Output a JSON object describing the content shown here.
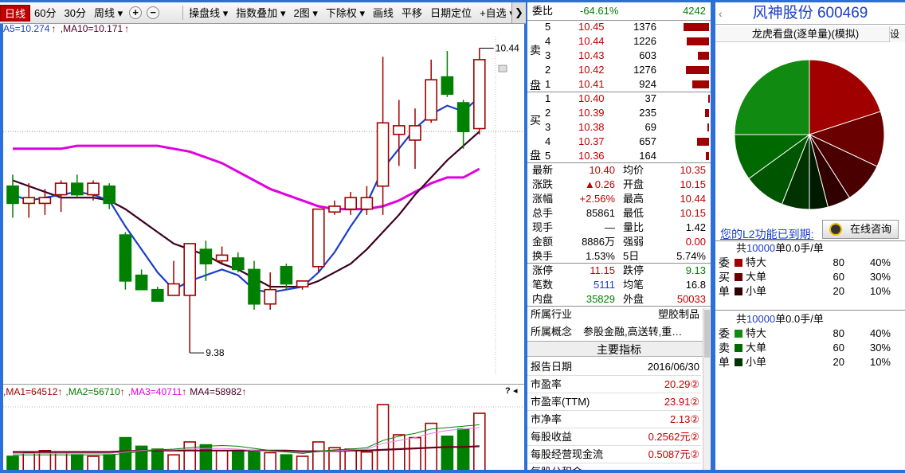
{
  "toolbar": {
    "period_tabs": [
      "日线",
      "60分",
      "30分",
      "周线"
    ],
    "active_period": "日线",
    "buttons": [
      "操盘线",
      "指数叠加",
      "2图",
      "下除权",
      "画线",
      "平移",
      "日期定位",
      "自选"
    ],
    "plus": "+",
    "minus": "−",
    "dropdown_arrow": "▾",
    "hide_icon": "❯"
  },
  "main_chart": {
    "ma_legend": [
      {
        "text": "A5=10.274",
        "color": "#1a3ec8"
      },
      {
        "text": ",MA10=10.171",
        "color": "#4a0020"
      }
    ],
    "price_high_label": "10.44",
    "price_low_label": "9.38",
    "colors": {
      "up": "#a00000",
      "down": "#008000",
      "ma5": "#1a3ec8",
      "ma10": "#3c0022",
      "ma_long": "#e000e0"
    }
  },
  "chart_data": {
    "type": "candlestick",
    "price_range": [
      9.3,
      10.48
    ],
    "candles": [
      {
        "o": 9.96,
        "c": 9.9,
        "h": 10.0,
        "l": 9.85
      },
      {
        "o": 9.9,
        "c": 9.92,
        "h": 9.97,
        "l": 9.85
      },
      {
        "o": 9.9,
        "c": 9.92,
        "h": 9.95,
        "l": 9.86
      },
      {
        "o": 9.93,
        "c": 9.97,
        "h": 9.98,
        "l": 9.87
      },
      {
        "o": 9.97,
        "c": 9.93,
        "h": 10.0,
        "l": 9.92
      },
      {
        "o": 9.93,
        "c": 9.97,
        "h": 9.98,
        "l": 9.91
      },
      {
        "o": 9.96,
        "c": 9.9,
        "h": 9.97,
        "l": 9.88
      },
      {
        "o": 9.79,
        "c": 9.63,
        "h": 9.8,
        "l": 9.6
      },
      {
        "o": 9.65,
        "c": 9.6,
        "h": 9.67,
        "l": 9.6
      },
      {
        "o": 9.6,
        "c": 9.56,
        "h": 9.61,
        "l": 9.56
      },
      {
        "o": 9.58,
        "c": 9.62,
        "h": 9.7,
        "l": 9.58
      },
      {
        "o": 9.58,
        "c": 9.76,
        "h": 9.76,
        "l": 9.38
      },
      {
        "o": 9.74,
        "c": 9.69,
        "h": 9.77,
        "l": 9.63
      },
      {
        "o": 9.7,
        "c": 9.72,
        "h": 9.75,
        "l": 9.69
      },
      {
        "o": 9.71,
        "c": 9.67,
        "h": 9.73,
        "l": 9.66
      },
      {
        "o": 9.67,
        "c": 9.55,
        "h": 9.7,
        "l": 9.53
      },
      {
        "o": 9.55,
        "c": 9.6,
        "h": 9.66,
        "l": 9.53
      },
      {
        "o": 9.68,
        "c": 9.62,
        "h": 9.69,
        "l": 9.6
      },
      {
        "o": 9.61,
        "c": 9.63,
        "h": 9.63,
        "l": 9.6
      },
      {
        "o": 9.68,
        "c": 9.88,
        "h": 9.88,
        "l": 9.66
      },
      {
        "o": 9.87,
        "c": 9.89,
        "h": 9.91,
        "l": 9.86
      },
      {
        "o": 9.88,
        "c": 9.92,
        "h": 9.94,
        "l": 9.86
      },
      {
        "o": 9.88,
        "c": 9.92,
        "h": 9.96,
        "l": 9.86
      },
      {
        "o": 9.96,
        "c": 10.18,
        "h": 10.41,
        "l": 9.86
      },
      {
        "o": 10.14,
        "c": 10.17,
        "h": 10.26,
        "l": 10.03
      },
      {
        "o": 10.12,
        "c": 10.17,
        "h": 10.23,
        "l": 10.02
      },
      {
        "o": 10.19,
        "c": 10.33,
        "h": 10.4,
        "l": 10.18
      },
      {
        "o": 10.34,
        "c": 10.28,
        "h": 10.43,
        "l": 10.27
      },
      {
        "o": 10.25,
        "c": 10.15,
        "h": 10.26,
        "l": 10.09
      },
      {
        "o": 10.16,
        "c": 10.4,
        "h": 10.44,
        "l": 10.14
      }
    ],
    "ma5": [
      9.93,
      9.91,
      9.92,
      9.93,
      9.94,
      9.93,
      9.91,
      9.82,
      9.74,
      9.66,
      9.6,
      9.63,
      9.65,
      9.67,
      9.65,
      9.6,
      9.59,
      9.6,
      9.61,
      9.66,
      9.73,
      9.82,
      9.9,
      10.02,
      10.09,
      10.16,
      10.21,
      10.24,
      10.22,
      10.27
    ],
    "ma10": [
      9.98,
      9.96,
      9.94,
      9.92,
      9.92,
      9.92,
      9.91,
      9.88,
      9.84,
      9.8,
      9.76,
      9.74,
      9.72,
      9.69,
      9.67,
      9.64,
      9.61,
      9.61,
      9.61,
      9.63,
      9.66,
      9.69,
      9.74,
      9.8,
      9.86,
      9.93,
      9.99,
      10.05,
      10.1,
      10.15
    ],
    "ma_long": [
      10.09,
      10.09,
      10.09,
      10.09,
      10.1,
      10.1,
      10.1,
      10.1,
      10.1,
      10.1,
      10.09,
      10.08,
      10.06,
      10.04,
      10.01,
      9.98,
      9.95,
      9.93,
      9.91,
      9.89,
      9.88,
      9.88,
      9.88,
      9.89,
      9.91,
      9.94,
      9.97,
      9.99,
      9.99,
      10.02
    ],
    "volumes": [
      20,
      25,
      28,
      26,
      22,
      20,
      22,
      46,
      34,
      30,
      22,
      40,
      36,
      28,
      27,
      28,
      25,
      22,
      20,
      40,
      32,
      30,
      26,
      92,
      50,
      46,
      66,
      48,
      58,
      80
    ],
    "vol_ma_a": [
      26,
      26,
      26,
      26,
      26,
      26,
      26,
      27,
      28,
      28,
      28,
      28,
      28,
      28,
      28,
      28,
      28,
      28,
      27,
      27,
      27,
      28,
      28,
      29,
      30,
      31,
      32,
      33,
      33,
      34
    ],
    "vol_ma_b": [
      24,
      24,
      24,
      24,
      24,
      24,
      24,
      26,
      28,
      29,
      29,
      30,
      31,
      31,
      30,
      28,
      27,
      26,
      25,
      26,
      27,
      29,
      30,
      38,
      42,
      46,
      52,
      56,
      58,
      60
    ],
    "vol_ma_c": [
      22,
      22,
      22,
      22,
      22,
      22,
      22,
      24,
      27,
      29,
      30,
      32,
      34,
      35,
      34,
      31,
      28,
      26,
      24,
      27,
      29,
      30,
      32,
      42,
      48,
      52,
      58,
      60,
      62,
      64
    ],
    "vol_range": [
      0,
      100
    ]
  },
  "sub_chart": {
    "legend": [
      {
        "text": ",MA1=64512",
        "color": "#a00000"
      },
      {
        "text": "↑",
        "color": "#a00000"
      },
      {
        "text": ",MA2=56710",
        "color": "#008000"
      },
      {
        "text": "↑",
        "color": "#a00000"
      },
      {
        "text": ",MA3=40711",
        "color": "#e000e0"
      },
      {
        "text": "↑",
        "color": "#a00000"
      },
      {
        "text": "MA4=58982",
        "color": "#4a0020"
      },
      {
        "text": "↑",
        "color": "#a00000"
      }
    ],
    "help_icon": "?",
    "arrow_icon": "◂"
  },
  "order_book": {
    "weibi_label": "委比",
    "weibi_value": "-64.61%",
    "weicha_value": "4242",
    "sell_label": [
      "卖",
      "盘"
    ],
    "buy_label": [
      "买",
      "盘"
    ],
    "sell": [
      {
        "lvl": "5",
        "price": "10.45",
        "vol": "1376",
        "bar": 32
      },
      {
        "lvl": "4",
        "price": "10.44",
        "vol": "1226",
        "bar": 28
      },
      {
        "lvl": "3",
        "price": "10.43",
        "vol": "603",
        "bar": 14
      },
      {
        "lvl": "2",
        "price": "10.42",
        "vol": "1276",
        "bar": 29
      },
      {
        "lvl": "1",
        "price": "10.41",
        "vol": "924",
        "bar": 21
      }
    ],
    "buy": [
      {
        "lvl": "1",
        "price": "10.40",
        "vol": "37",
        "bar": 1
      },
      {
        "lvl": "2",
        "price": "10.39",
        "vol": "235",
        "bar": 5
      },
      {
        "lvl": "3",
        "price": "10.38",
        "vol": "69",
        "bar": 2
      },
      {
        "lvl": "4",
        "price": "10.37",
        "vol": "657",
        "bar": 15
      },
      {
        "lvl": "5",
        "price": "10.36",
        "vol": "164",
        "bar": 4
      }
    ],
    "quotes": [
      {
        "l1": "最新",
        "v1": "10.40",
        "c1": "red",
        "l2": "均价",
        "v2": "10.35",
        "c2": "red"
      },
      {
        "l1": "涨跌",
        "v1": "▲0.26",
        "c1": "red",
        "l2": "开盘",
        "v2": "10.15",
        "c2": "red"
      },
      {
        "l1": "涨幅",
        "v1": "+2.56%",
        "c1": "red",
        "l2": "最高",
        "v2": "10.44",
        "c2": "red"
      },
      {
        "l1": "总手",
        "v1": "85861",
        "c1": "black",
        "l2": "最低",
        "v2": "10.15",
        "c2": "red"
      },
      {
        "l1": "现手",
        "v1": "—",
        "c1": "black",
        "l2": "量比",
        "v2": "1.42",
        "c2": "black"
      },
      {
        "l1": "金额",
        "v1": "8886万",
        "c1": "black",
        "l2": "强弱",
        "v2": "0.00",
        "c2": "red"
      },
      {
        "l1": "换手",
        "v1": "1.53%",
        "c1": "black",
        "l2": "5日",
        "v2": "5.74%",
        "c2": "black"
      }
    ],
    "limits": [
      {
        "l1": "涨停",
        "v1": "11.15",
        "c1": "red",
        "l2": "跌停",
        "v2": "9.13",
        "c2": "green"
      },
      {
        "l1": "笔数",
        "v1": "5111",
        "c1": "blue",
        "l2": "均笔",
        "v2": "16.8",
        "c2": "black"
      },
      {
        "l1": "内盘",
        "v1": "35829",
        "c1": "green",
        "l2": "外盘",
        "v2": "50033",
        "c2": "red"
      }
    ],
    "industry_label": "所属行业",
    "industry_value": "塑胶制品",
    "concept_label": "所属概念",
    "concept_value": "参股金融,高送转,重…",
    "indicator_title": "主要指标",
    "indicators": [
      {
        "k": "报告日期",
        "v": "2016/06/30",
        "color": "#000"
      },
      {
        "k": "市盈率",
        "v": "20.29②",
        "color": "#c00000"
      },
      {
        "k": "市盈率(TTM)",
        "v": "23.91②",
        "color": "#c00000"
      },
      {
        "k": "市净率",
        "v": "2.13②",
        "color": "#c00000"
      },
      {
        "k": "每股收益",
        "v": "0.2562元②",
        "color": "#c00000"
      },
      {
        "k": "每股经营现金流",
        "v": "0.5087元②",
        "color": "#c00000"
      },
      {
        "k": "每股公积金",
        "v": "",
        "color": "#c00000"
      }
    ]
  },
  "right_panel": {
    "stock_name": "风神股份",
    "stock_code": "600469",
    "arrow": "‹",
    "pie_title": "龙虎看盘(逐单量)(模拟)",
    "pie_tab": "设",
    "pie_slices": [
      {
        "value": 20,
        "color": "#a00000"
      },
      {
        "value": 12,
        "color": "#6a0000"
      },
      {
        "value": 9,
        "color": "#4a0000"
      },
      {
        "value": 5,
        "color": "#300000"
      },
      {
        "value": 4,
        "color": "#001a00"
      },
      {
        "value": 6,
        "color": "#003300"
      },
      {
        "value": 9,
        "color": "#005500"
      },
      {
        "value": 10,
        "color": "#006a00"
      },
      {
        "value": 25,
        "color": "#108a10"
      }
    ],
    "l2_link": "您的L2功能已到期:",
    "consult_btn": "在线咨询",
    "buy_flow": {
      "header_prefix": "共",
      "header_num": "10000",
      "header_suffix": "单0.0手/单",
      "side": [
        "委",
        "买",
        "单"
      ],
      "rows": [
        {
          "label": "特大",
          "vol": "80",
          "pct": "40%",
          "color": "#a00000"
        },
        {
          "label": "大单",
          "vol": "60",
          "pct": "30%",
          "color": "#6a0000"
        },
        {
          "label": "小单",
          "vol": "20",
          "pct": "10%",
          "color": "#300000"
        }
      ]
    },
    "sell_flow": {
      "header_prefix": "共",
      "header_num": "10000",
      "header_suffix": "单0.0手/单",
      "side": [
        "委",
        "卖",
        "单"
      ],
      "rows": [
        {
          "label": "特大",
          "vol": "80",
          "pct": "40%",
          "color": "#108a10"
        },
        {
          "label": "大单",
          "vol": "60",
          "pct": "30%",
          "color": "#006a00"
        },
        {
          "label": "小单",
          "vol": "20",
          "pct": "10%",
          "color": "#003300"
        }
      ]
    }
  }
}
